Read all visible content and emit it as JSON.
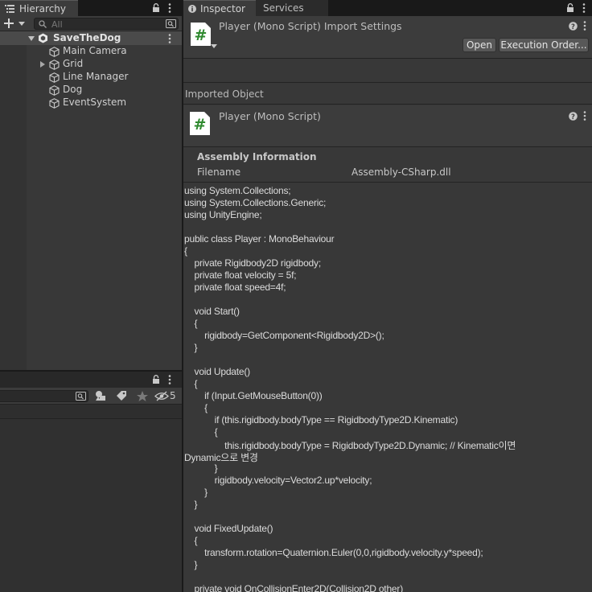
{
  "hierarchy": {
    "tab_label": "Hierarchy",
    "search_placeholder": "All",
    "scene": "SaveTheDog",
    "objects": [
      {
        "name": "Main Camera",
        "expandable": false
      },
      {
        "name": "Grid",
        "expandable": true
      },
      {
        "name": "Line Manager",
        "expandable": false
      },
      {
        "name": "Dog",
        "expandable": false
      },
      {
        "name": "EventSystem",
        "expandable": false
      }
    ]
  },
  "project": {
    "hidden_count": "5"
  },
  "inspector": {
    "tabs": [
      "Inspector",
      "Services"
    ],
    "header_title": "Player (Mono Script) Import Settings",
    "open_button": "Open",
    "exec_order_button": "Execution Order...",
    "imported_object_label": "Imported Object",
    "object_title": "Player (Mono Script)",
    "assembly_heading": "Assembly Information",
    "filename_label": "Filename",
    "filename_value": "Assembly-CSharp.dll"
  },
  "code_lines": [
    "using System.Collections;",
    "using System.Collections.Generic;",
    "using UnityEngine;",
    "",
    "public class Player : MonoBehaviour",
    "{",
    "    private Rigidbody2D rigidbody;",
    "    private float velocity = 5f;",
    "    private float speed=4f;",
    "",
    "    void Start()",
    "    {",
    "        rigidbody=GetComponent<Rigidbody2D>();",
    "    }",
    "",
    "    void Update()",
    "    {",
    "        if (Input.GetMouseButton(0))",
    "        {",
    "            if (this.rigidbody.bodyType == RigidbodyType2D.Kinematic)",
    "            {",
    "                this.rigidbody.bodyType = RigidbodyType2D.Dynamic; // Kinematic이면",
    "Dynamic으로 변경",
    "            }",
    "            rigidbody.velocity=Vector2.up*velocity;",
    "        }",
    "    }",
    "",
    "    void FixedUpdate()",
    "    {",
    "        transform.rotation=Quaternion.Euler(0,0,rigidbody.velocity.y*speed);",
    "    }",
    "",
    "    private void OnCollisionEnter2D(Collision2D other)"
  ],
  "colors": {
    "script_icon_bg": "#ffffff",
    "script_icon_hash": "#2f8a2f"
  }
}
